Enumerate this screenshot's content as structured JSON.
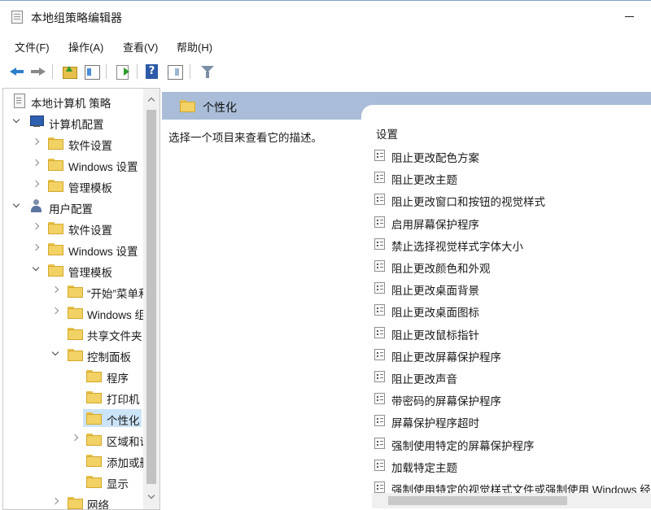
{
  "window": {
    "title": "本地组策略编辑器"
  },
  "menu": [
    "文件(F)",
    "操作(A)",
    "查看(V)",
    "帮助(H)"
  ],
  "toolbar": {
    "icons": [
      "back-arrow-icon",
      "forward-arrow-icon",
      "up-folder-icon",
      "show-hide-tree-icon",
      "export-list-icon",
      "help-icon",
      "show-hide-action-pane-icon",
      "filter-icon"
    ]
  },
  "tree": [
    {
      "label": "本地计算机 策略",
      "icon": "policy-root-icon",
      "expander": "none"
    },
    {
      "label": "计算机配置",
      "icon": "computer-icon",
      "expander": "down"
    },
    {
      "label": "软件设置",
      "icon": "folder-icon",
      "expander": "right"
    },
    {
      "label": "Windows 设置",
      "icon": "folder-icon",
      "expander": "right"
    },
    {
      "label": "管理模板",
      "icon": "folder-icon",
      "expander": "right"
    },
    {
      "label": "用户配置",
      "icon": "user-icon",
      "expander": "down"
    },
    {
      "label": "软件设置",
      "icon": "folder-icon",
      "expander": "right"
    },
    {
      "label": "Windows 设置",
      "icon": "folder-icon",
      "expander": "right"
    },
    {
      "label": "管理模板",
      "icon": "folder-icon",
      "expander": "down"
    },
    {
      "label": "“开始”菜单和任务栏",
      "icon": "folder-icon",
      "expander": "right"
    },
    {
      "label": "Windows 组件",
      "icon": "folder-icon",
      "expander": "right"
    },
    {
      "label": "共享文件夹",
      "icon": "folder-icon",
      "expander": "none"
    },
    {
      "label": "控制面板",
      "icon": "folder-icon",
      "expander": "down"
    },
    {
      "label": "程序",
      "icon": "folder-icon",
      "expander": "none"
    },
    {
      "label": "打印机",
      "icon": "folder-icon",
      "expander": "none"
    },
    {
      "label": "个性化",
      "icon": "folder-icon",
      "expander": "none",
      "selected": true
    },
    {
      "label": "区域和语言",
      "icon": "folder-icon",
      "expander": "right"
    },
    {
      "label": "添加或删除程序",
      "icon": "folder-icon",
      "expander": "none"
    },
    {
      "label": "显示",
      "icon": "folder-icon",
      "expander": "none"
    },
    {
      "label": "网络",
      "icon": "folder-icon",
      "expander": "right"
    }
  ],
  "details": {
    "header": "个性化",
    "description": "选择一个项目来查看它的描述。",
    "column_header": "设置",
    "settings": [
      "阻止更改配色方案",
      "阻止更改主题",
      "阻止更改窗口和按钮的视觉样式",
      "启用屏幕保护程序",
      "禁止选择视觉样式字体大小",
      "阻止更改颜色和外观",
      "阻止更改桌面背景",
      "阻止更改桌面图标",
      "阻止更改鼠标指针",
      "阻止更改屏幕保护程序",
      "阻止更改声音",
      "带密码的屏幕保护程序",
      "屏幕保护程序超时",
      "强制使用特定的屏幕保护程序",
      "加载特定主题",
      "强制使用特定的视觉样式文件或强制使用 Windows 经典"
    ]
  }
}
